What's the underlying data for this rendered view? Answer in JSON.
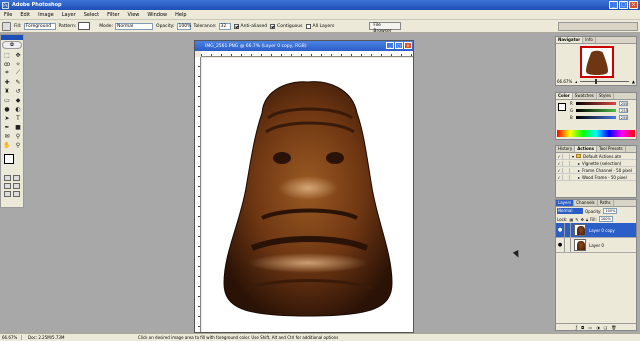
{
  "app": {
    "title": "Adobe Photoshop"
  },
  "window_controls": {
    "minimize": "_",
    "maximize": "□",
    "close": "×"
  },
  "menu": [
    "File",
    "Edit",
    "Image",
    "Layer",
    "Select",
    "Filter",
    "View",
    "Window",
    "Help"
  ],
  "options_bar": {
    "fill_label": "Fill:",
    "fill_value": "Foreground",
    "pattern_label": "Pattern:",
    "mode_label": "Mode:",
    "mode_value": "Normal",
    "opacity_label": "Opacity:",
    "opacity_value": "100%",
    "tolerance_label": "Tolerance:",
    "tolerance_value": "32",
    "anti_aliased": "Anti-aliased",
    "contiguous": "Contiguous",
    "all_layers": "All Layers",
    "file_browser": "File Browser"
  },
  "document": {
    "title": "IMG_2561.PNG @ 66.7% (Layer 0 copy, RGB)"
  },
  "status": {
    "zoom": "66.67%",
    "doc": "Doc: 2.25M/5.73M",
    "hint": "Click on desired image area to fill with foreground color. Use Shift, Alt and Ctrl for additional options"
  },
  "navigator": {
    "tabs": [
      "Navigator",
      "Info"
    ],
    "zoom": "66.67%"
  },
  "color_panel": {
    "tabs": [
      "Color",
      "Swatches",
      "Styles"
    ],
    "channels": [
      {
        "label": "R",
        "value": "255",
        "bar": "#e04848"
      },
      {
        "label": "G",
        "value": "255",
        "bar": "#48c048"
      },
      {
        "label": "B",
        "value": "255",
        "bar": "#4878e0"
      }
    ]
  },
  "actions_panel": {
    "tabs": [
      "History",
      "Actions",
      "Tool Presets"
    ],
    "items": [
      {
        "label": "Default Actions.atn",
        "indent": 0
      },
      {
        "label": "Vignette (selection)",
        "indent": 1
      },
      {
        "label": "Frame Channel - 50 pixel",
        "indent": 1
      },
      {
        "label": "Wood Frame - 50 pixel",
        "indent": 1
      }
    ]
  },
  "layers_panel": {
    "tabs": [
      "Layers",
      "Channels",
      "Paths"
    ],
    "blend_mode": "Normal",
    "opacity_label": "Opacity:",
    "opacity_value": "100%",
    "lock_label": "Lock:",
    "fill_label": "Fill:",
    "fill_value": "100%",
    "layers": [
      {
        "name": "Layer 0 copy",
        "selected": true
      },
      {
        "name": "Layer 0",
        "selected": false
      }
    ]
  }
}
